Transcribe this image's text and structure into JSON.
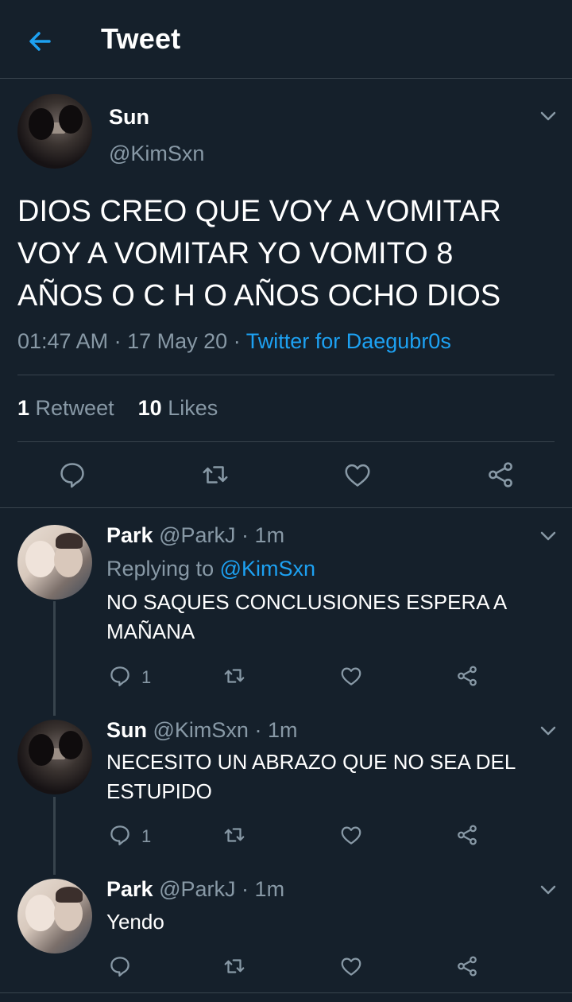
{
  "header": {
    "title": "Tweet",
    "back_icon": "arrow-left-icon"
  },
  "main_tweet": {
    "name": "Sun",
    "handle": "@KimSxn",
    "text_lines": [
      "DIOS CREO QUE VOY A VOMITAR",
      "VOY A VOMITAR YO VOMITO 8",
      "AÑOS O C H O AÑOS OCHO DIOS"
    ],
    "time": "01:47 AM",
    "date": "17 May 20",
    "source": "Twitter for Daegubr0s",
    "sep": "·",
    "retweets_count": "1",
    "retweets_label": "Retweet",
    "likes_count": "10",
    "likes_label": "Likes"
  },
  "replies": [
    {
      "name": "Park",
      "handle": "@ParkJ",
      "time": "1m",
      "replying_prefix": "Replying to",
      "replying_to": "@KimSxn",
      "text_lines": [
        "NO SAQUES CONCLUSIONES ESPERA A",
        "MAÑANA"
      ],
      "reply_count": "1"
    },
    {
      "name": "Sun",
      "handle": "@KimSxn",
      "time": "1m",
      "text_lines": [
        "NECESITO UN ABRAZO QUE NO SEA DEL",
        "ESTUPIDO"
      ],
      "reply_count": "1"
    },
    {
      "name": "Park",
      "handle": "@ParkJ",
      "time": "1m",
      "text_lines": [
        "Yendo"
      ],
      "reply_count": ""
    }
  ],
  "colors": {
    "background": "#15202b",
    "accent": "#1da1f2",
    "muted": "#8899a6",
    "divider": "#38444d"
  }
}
